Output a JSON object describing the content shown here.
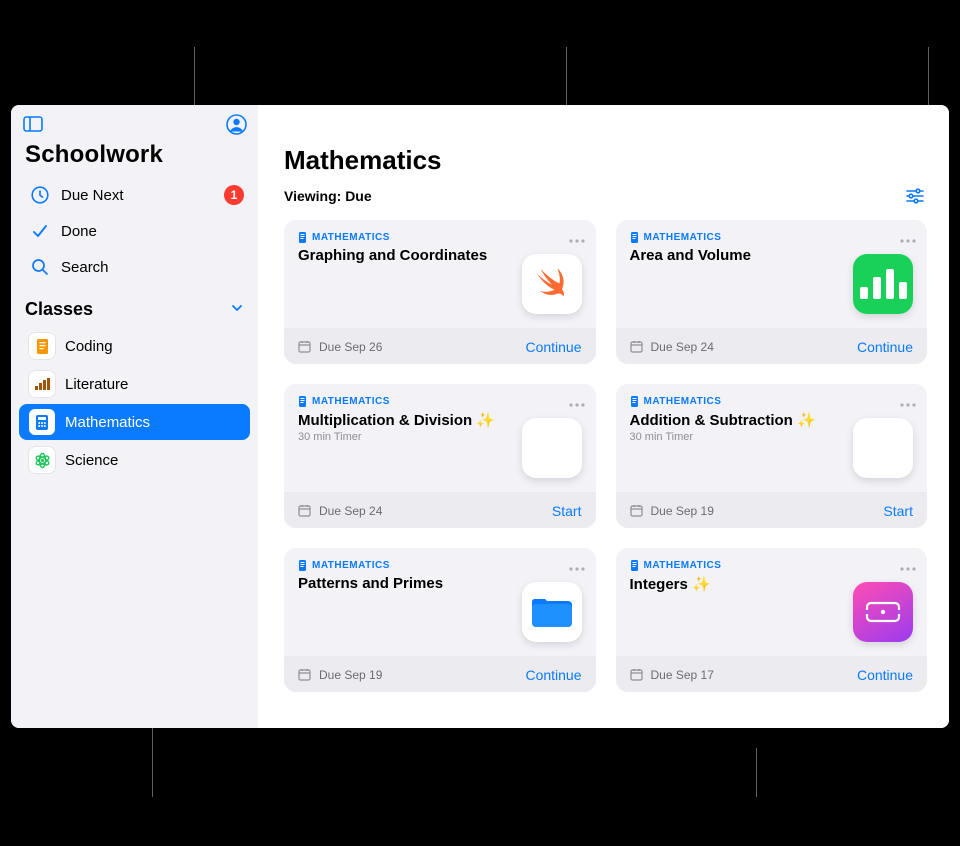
{
  "app_title": "Schoolwork",
  "nav": {
    "due_next": {
      "label": "Due Next",
      "badge": "1"
    },
    "done": {
      "label": "Done"
    },
    "search": {
      "label": "Search"
    }
  },
  "classes_section": {
    "title": "Classes"
  },
  "classes": [
    {
      "label": "Coding",
      "icon": "doc",
      "color": "#ff9500"
    },
    {
      "label": "Literature",
      "icon": "book",
      "color": "#a2540a"
    },
    {
      "label": "Mathematics",
      "icon": "calc",
      "color": "#0a7aff",
      "selected": true
    },
    {
      "label": "Science",
      "icon": "atom",
      "color": "#22c55e"
    }
  ],
  "page": {
    "title": "Mathematics",
    "viewing_label": "Viewing: Due"
  },
  "cards": [
    {
      "subject": "MATHEMATICS",
      "title": "Graphing and Coordinates",
      "sub": "",
      "due": "Due Sep 26",
      "action": "Continue",
      "thumb": "swift"
    },
    {
      "subject": "MATHEMATICS",
      "title": "Area and Volume",
      "sub": "",
      "due": "Due Sep 24",
      "action": "Continue",
      "thumb": "numbers"
    },
    {
      "subject": "MATHEMATICS",
      "title": "Multiplication & Division ✨",
      "sub": "30 min Timer",
      "due": "Due Sep 24",
      "action": "Start",
      "thumb": "notes"
    },
    {
      "subject": "MATHEMATICS",
      "title": "Addition & Subtraction ✨",
      "sub": "30 min Timer",
      "due": "Due Sep 19",
      "action": "Start",
      "thumb": "notes"
    },
    {
      "subject": "MATHEMATICS",
      "title": "Patterns and Primes",
      "sub": "",
      "due": "Due Sep 19",
      "action": "Continue",
      "thumb": "folder"
    },
    {
      "subject": "MATHEMATICS",
      "title": "Integers ✨",
      "sub": "",
      "due": "Due Sep 17",
      "action": "Continue",
      "thumb": "ticket"
    }
  ]
}
